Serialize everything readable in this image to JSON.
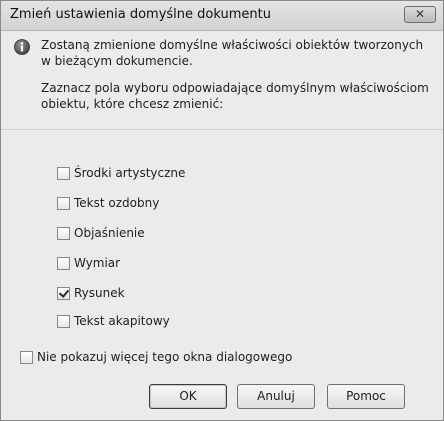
{
  "dialog": {
    "title": "Zmień ustawienia domyślne dokumentu",
    "close_icon": "close-icon",
    "info_icon": "info-icon",
    "info_text": "Zostaną zmienione domyślne właściwości obiektów tworzonych w bieżącym dokumencie.",
    "prompt_text": "Zaznacz pola wyboru odpowiadające domyślnym właściwościom obiektu, które chcesz zmienić:",
    "options": [
      {
        "label": "Środki artystyczne",
        "checked": false
      },
      {
        "label": "Tekst ozdobny",
        "checked": false
      },
      {
        "label": "Objaśnienie",
        "checked": false
      },
      {
        "label": "Wymiar",
        "checked": false
      },
      {
        "label": "Rysunek",
        "checked": true
      },
      {
        "label": "Tekst akapitowy",
        "checked": false
      }
    ],
    "dont_show_label": "Nie pokazuj więcej tego okna dialogowego",
    "dont_show_checked": false,
    "buttons": {
      "ok": "OK",
      "cancel": "Anuluj",
      "help": "Pomoc"
    }
  }
}
